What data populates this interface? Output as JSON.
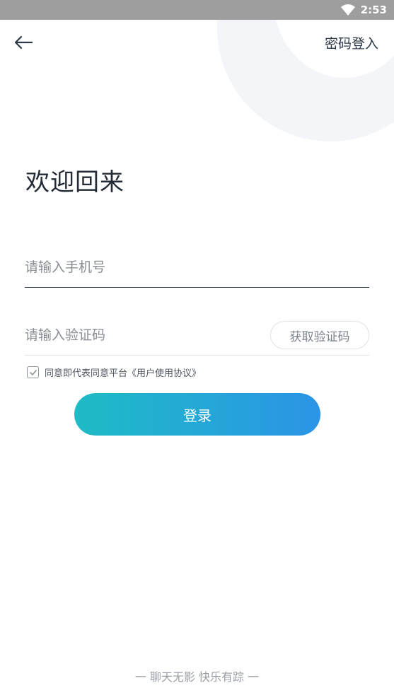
{
  "status_bar": {
    "time": "2:53",
    "wifi_icon": "wifi-icon"
  },
  "header": {
    "back_icon": "arrow-left-icon",
    "password_login_label": "密码登入"
  },
  "title": "欢迎回来",
  "phone_input": {
    "placeholder": "请输入手机号",
    "value": ""
  },
  "code_input": {
    "placeholder": "请输入验证码",
    "value": ""
  },
  "get_code_label": "获取验证码",
  "agreement": {
    "checked": true,
    "text": "同意即代表同意平台《用户使用协议》"
  },
  "login_label": "登录",
  "footer": "一 聊天无影 快乐有踪 一",
  "colors": {
    "accent_start": "#1ebcc6",
    "accent_end": "#2b94e6",
    "status_bar": "#9e9e9e"
  }
}
